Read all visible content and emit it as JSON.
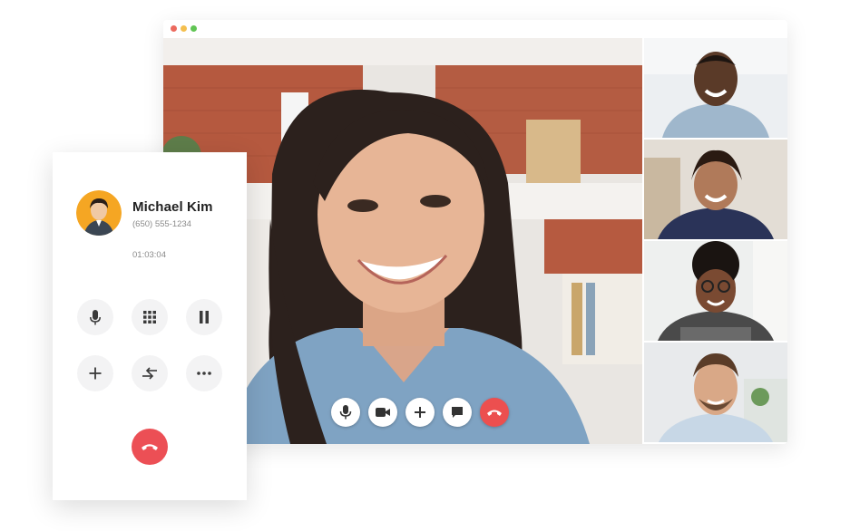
{
  "caller": {
    "name": "Michael Kim",
    "phone": "(650) 555-1234",
    "duration": "01:03:04"
  },
  "icons": {
    "mute": "microphone-icon",
    "keypad": "keypad-icon",
    "hold": "pause-icon",
    "add": "plus-icon",
    "transfer": "transfer-icon",
    "more": "more-icon",
    "hangup": "phone-hangup-icon",
    "video": "video-camera-icon",
    "chat": "chat-icon"
  },
  "colors": {
    "hangup": "#ec4f4f",
    "window_dot_red": "#ec6a5e",
    "window_dot_yellow": "#f4bf4f",
    "window_dot_green": "#61c554"
  }
}
